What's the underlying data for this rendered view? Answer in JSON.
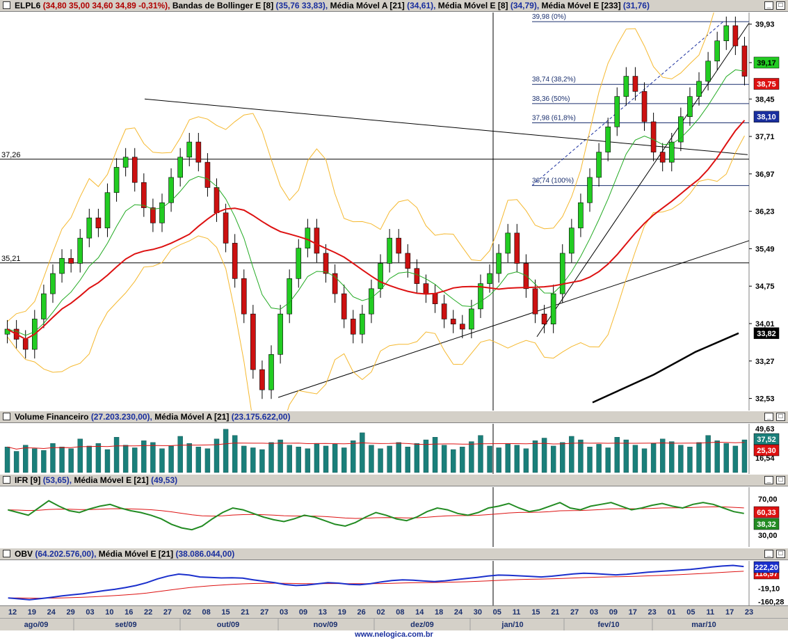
{
  "price_panel": {
    "header": {
      "ticker": "ELPL6",
      "quote": "(34,80  35,00  34,60  34,89  -0,31%),",
      "ind1_name": "Bandas de Bollinger E [8]",
      "ind1_vals": "(35,76  33,83),",
      "ind2_name": "Média Móvel A [21]",
      "ind2_vals": "(34,61),",
      "ind3_name": "Média Móvel E [8]",
      "ind3_vals": "(34,79),",
      "ind4_name": "Média Móvel E [233]",
      "ind4_vals": "(31,76)"
    },
    "y_ticks": [
      "39,93",
      "39,17",
      "38,45",
      "37,71",
      "36,97",
      "36,23",
      "35,49",
      "34,75",
      "34,01",
      "33,27",
      "32,53"
    ],
    "h_lines": [
      {
        "label": "37,26",
        "value": 37.26
      },
      {
        "label": "35,21",
        "value": 35.21
      }
    ],
    "fibonacci": [
      {
        "label": "39,98 (0%)",
        "value": 39.98
      },
      {
        "label": "38,74 (38,2%)",
        "value": 38.74
      },
      {
        "label": "38,36 (50%)",
        "value": 38.36
      },
      {
        "label": "37,98 (61,8%)",
        "value": 37.98
      },
      {
        "label": "36,74 (100%)",
        "value": 36.74
      }
    ],
    "badges": [
      {
        "label": "39,17",
        "value": 39.17,
        "color": "#22cc22",
        "text": "#000000"
      },
      {
        "label": "38,75",
        "value": 38.75,
        "color": "#dd1111",
        "text": "#ffffff"
      },
      {
        "label": "38,10",
        "value": 38.1,
        "color": "#1a2f9e",
        "text": "#ffffff"
      },
      {
        "label": "33,82",
        "value": 33.82,
        "color": "#000000",
        "text": "#ffffff"
      }
    ]
  },
  "volume_panel": {
    "header": {
      "title": "Volume Financeiro",
      "title_vals": "(27.203.230,00),",
      "ma_name": "Média Móvel A [21]",
      "ma_vals": "(23.175.622,00)"
    },
    "y_ticks": [
      "49,63",
      "16,54"
    ],
    "badges": [
      {
        "label": "37,52",
        "color": "#1a7f7a",
        "text": "#ffffff"
      },
      {
        "label": "25,30",
        "color": "#dd1111",
        "text": "#ffffff"
      }
    ]
  },
  "ifr_panel": {
    "header": {
      "title": "IFR [9]",
      "title_vals": "(53,65),",
      "ma_name": "Média Móvel E [21]",
      "ma_vals": "(49,53)"
    },
    "y_ticks": [
      "70,00",
      "30,00"
    ],
    "badges": [
      {
        "label": "60,33",
        "color": "#dd1111",
        "text": "#ffffff"
      },
      {
        "label": "38,32",
        "color": "#228b22",
        "text": "#ffffff"
      }
    ]
  },
  "obv_panel": {
    "header": {
      "title": "OBV",
      "title_vals": "(64.202.576,00),",
      "ma_name": "Média Móvel E [21]",
      "ma_vals": "(38.086.044,00)"
    },
    "y_ticks": [
      "-19,10",
      "-160,28"
    ],
    "badges": [
      {
        "label": "222,20",
        "color": "#1a2fcc",
        "text": "#ffffff"
      },
      {
        "label": "118,97",
        "color": "#dd1111",
        "text": "#ffffff"
      }
    ]
  },
  "x_axis": {
    "day_ticks": [
      "12",
      "19",
      "24",
      "29",
      "03",
      "10",
      "16",
      "22",
      "27",
      "02",
      "08",
      "15",
      "21",
      "27",
      "03",
      "09",
      "13",
      "19",
      "26",
      "02",
      "08",
      "14",
      "18",
      "24",
      "30",
      "05",
      "11",
      "15",
      "21",
      "27",
      "03",
      "09",
      "17",
      "23",
      "01",
      "05",
      "11",
      "17",
      "23"
    ],
    "months": [
      "ago/09",
      "set/09",
      "out/09",
      "nov/09",
      "dez/09",
      "jan/10",
      "fev/10",
      "mar/10"
    ]
  },
  "colors": {
    "bull": "#22cc22",
    "bear": "#cc1111",
    "ma21": "#dd1111",
    "ema8": "#22aa22",
    "bollinger": "#f5b82e",
    "ema233": "#000000",
    "volume": "#1a7f7a",
    "ifr": "#228b22",
    "obv": "#1a2fcc"
  },
  "footer": {
    "url": "www.nelogica.com.br"
  },
  "chart_data": {
    "type": "line",
    "series": [
      {
        "name": "ELPL6",
        "values": [
          33.9,
          33.7,
          33.5,
          34.1,
          34.6,
          35.0,
          35.3,
          35.2,
          35.7,
          36.1,
          35.9,
          36.6,
          37.1,
          37.3,
          36.8,
          36.3,
          36.0,
          36.4,
          36.9,
          37.3,
          37.6,
          37.2,
          36.7,
          36.2,
          35.6,
          34.9,
          34.2,
          33.1,
          32.7,
          33.4,
          34.2,
          34.9,
          35.5,
          35.9,
          35.4,
          35.0,
          34.6,
          34.1,
          33.8,
          34.2,
          34.7,
          35.2,
          35.7,
          35.4,
          35.1,
          34.8,
          34.6,
          34.4,
          34.1,
          34.0,
          33.9,
          34.3,
          34.8,
          35.0,
          35.4,
          35.8,
          35.2,
          34.7,
          34.2,
          34.0,
          34.6,
          35.4,
          35.9,
          36.4,
          36.9,
          37.4,
          37.9,
          38.5,
          38.9,
          38.6,
          38.0,
          37.4,
          37.2,
          37.6,
          38.1,
          38.5,
          38.8,
          39.2,
          39.6,
          39.9,
          39.5,
          38.9
        ]
      },
      {
        "name": "ELPL6 volume",
        "values": [
          29,
          24,
          31,
          27,
          25,
          33,
          29,
          27,
          38,
          30,
          33,
          26,
          40,
          31,
          28,
          36,
          34,
          27,
          30,
          41,
          33,
          29,
          27,
          38,
          49,
          42,
          30,
          28,
          26,
          34,
          37,
          31,
          29,
          27,
          33,
          30,
          32,
          28,
          36,
          45,
          31,
          27,
          30,
          34,
          29,
          33,
          37,
          40,
          31,
          26,
          29,
          35,
          42,
          30,
          28,
          33,
          31,
          27,
          36,
          39,
          30,
          34,
          41,
          37,
          29,
          32,
          28,
          40,
          37,
          31,
          27,
          33,
          38,
          35,
          31,
          29,
          34,
          42,
          36,
          33,
          30,
          37
        ]
      },
      {
        "name": "IFR [9]",
        "values": [
          58,
          55,
          52,
          60,
          68,
          62,
          57,
          55,
          59,
          62,
          64,
          60,
          57,
          55,
          52,
          48,
          42,
          38,
          36,
          40,
          48,
          55,
          60,
          58,
          54,
          50,
          47,
          45,
          48,
          52,
          50,
          46,
          42,
          40,
          44,
          50,
          55,
          52,
          48,
          46,
          50,
          56,
          60,
          58,
          54,
          52,
          55,
          60,
          62,
          65,
          60,
          56,
          58,
          62,
          66,
          60,
          58,
          62,
          64,
          66,
          62,
          58,
          60,
          63,
          65,
          62,
          60,
          64,
          66,
          64,
          60,
          56,
          54
        ]
      },
      {
        "name": "OBV",
        "values": [
          -120,
          -130,
          -140,
          -128,
          -115,
          -100,
          -88,
          -76,
          -60,
          -44,
          -30,
          -12,
          10,
          40,
          80,
          110,
          130,
          120,
          100,
          95,
          90,
          92,
          88,
          70,
          55,
          40,
          20,
          10,
          15,
          28,
          40,
          35,
          22,
          18,
          30,
          48,
          62,
          70,
          66,
          58,
          52,
          60,
          72,
          84,
          96,
          110,
          120,
          118,
          112,
          106,
          100,
          108,
          120,
          132,
          140,
          135,
          128,
          122,
          128,
          140,
          150,
          158,
          165,
          172,
          180,
          192,
          205,
          215,
          222,
          210
        ]
      }
    ],
    "ylim": [
      32.4,
      40.05
    ],
    "x_range": [
      "12 ago/09",
      "23 mar/10"
    ]
  }
}
